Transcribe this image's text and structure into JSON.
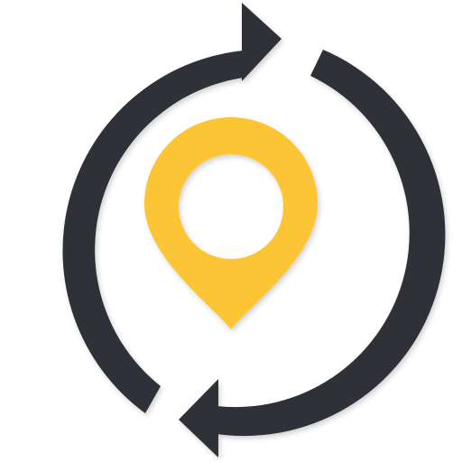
{
  "icon": {
    "name": "location-sync-icon",
    "arrow_color": "#2e3037",
    "pin_color": "#fbc534",
    "pin_hole_color": "#ffffff",
    "background_color": "#ffffff"
  }
}
